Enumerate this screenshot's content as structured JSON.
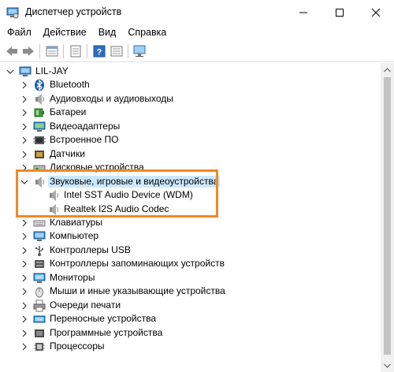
{
  "window": {
    "title": "Диспетчер устройств",
    "icon": "device-manager-icon"
  },
  "menu": {
    "file": "Файл",
    "action": "Действие",
    "view": "Вид",
    "help": "Справка"
  },
  "toolbar": {
    "icons": [
      "back-arrow-icon",
      "forward-arrow-icon",
      "properties-icon",
      "update-driver-icon",
      "help-icon",
      "show-hidden-icon",
      "monitor-scan-icon"
    ]
  },
  "tree": {
    "root": "LIL-JAY",
    "items": [
      {
        "label": "Bluetooth",
        "icon": "bluetooth-icon"
      },
      {
        "label": "Аудиовходы и аудиовыходы",
        "icon": "speaker-icon"
      },
      {
        "label": "Батареи",
        "icon": "battery-icon"
      },
      {
        "label": "Видеоадаптеры",
        "icon": "display-adapter-icon"
      },
      {
        "label": "Встроенное ПО",
        "icon": "firmware-icon"
      },
      {
        "label": "Датчики",
        "icon": "sensor-icon"
      },
      {
        "label": "Дисковые устройства",
        "icon": "disk-icon"
      },
      {
        "label": "Звуковые, игровые и видеоустройства",
        "icon": "speaker-icon"
      },
      {
        "label": "Intel SST Audio Device (WDM)",
        "icon": "speaker-icon"
      },
      {
        "label": "Realtek I2S Audio Codec",
        "icon": "speaker-icon"
      },
      {
        "label": "Клавиатуры",
        "icon": "keyboard-icon"
      },
      {
        "label": "Компьютер",
        "icon": "computer-icon"
      },
      {
        "label": "Контроллеры USB",
        "icon": "usb-icon"
      },
      {
        "label": "Контроллеры запоминающих устройств",
        "icon": "storage-controller-icon"
      },
      {
        "label": "Мониторы",
        "icon": "monitor-icon"
      },
      {
        "label": "Мыши и иные указывающие устройства",
        "icon": "mouse-icon"
      },
      {
        "label": "Очереди печати",
        "icon": "printer-icon"
      },
      {
        "label": "Переносные устройства",
        "icon": "portable-device-icon"
      },
      {
        "label": "Программные устройства",
        "icon": "software-device-icon"
      },
      {
        "label": "Процессоры",
        "icon": "processor-icon"
      }
    ]
  },
  "colors": {
    "selection": "#cce8ff",
    "highlight_border": "#f08a24"
  }
}
